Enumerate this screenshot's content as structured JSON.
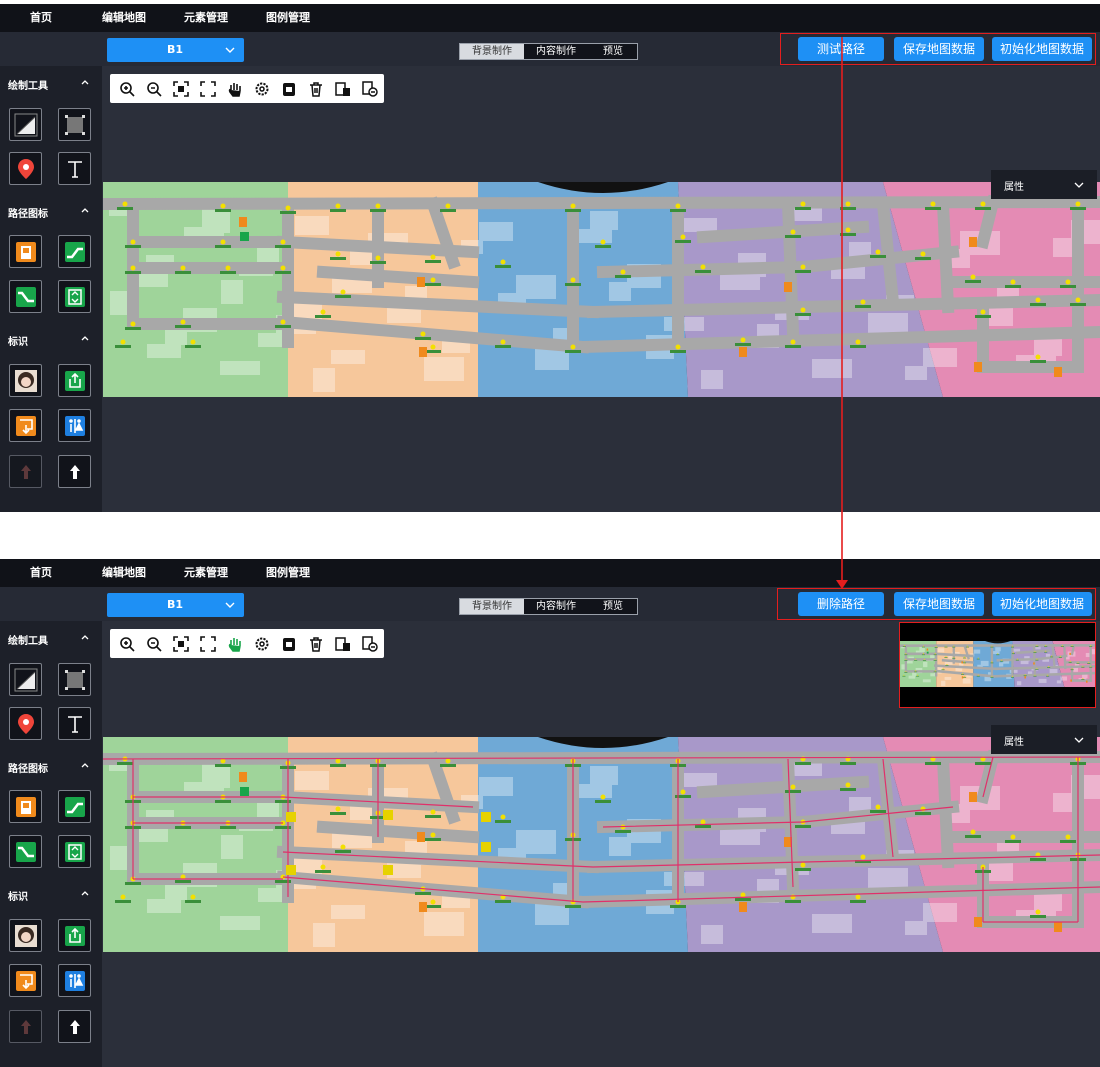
{
  "nav": {
    "items": [
      "首页",
      "编辑地图",
      "元素管理",
      "图例管理"
    ]
  },
  "floor": {
    "value": "B1"
  },
  "mode_tabs": [
    "背景制作",
    "内容制作",
    "预览"
  ],
  "actions_top": {
    "route_button": "测试路径",
    "save_button": "保存地图数据",
    "init_button": "初始化地图数据"
  },
  "actions_bottom": {
    "route_button": "删除路径",
    "save_button": "保存地图数据",
    "init_button": "初始化地图数据"
  },
  "sidebar": {
    "sections": [
      {
        "title": "绘制工具",
        "tools": [
          "line-tool-icon",
          "rect-select-tool-icon",
          "location-pin-icon",
          "text-tool-icon"
        ]
      },
      {
        "title": "路径图标",
        "tools": [
          "elevator-icon",
          "escalator-up-icon",
          "escalator-down-icon",
          "lift-icon"
        ]
      },
      {
        "title": "标识",
        "tools": [
          "avatar-icon",
          "exit-icon",
          "entrance-icon",
          "restroom-icon",
          "arrow-up-disabled-icon",
          "arrow-up-icon"
        ]
      }
    ]
  },
  "map_tools": [
    "zoom-in-icon",
    "zoom-out-icon",
    "fit-icon",
    "fullscreen-icon",
    "pan-hand-icon",
    "settings-icon",
    "lock-icon",
    "delete-icon",
    "copy-delete-icon",
    "copy-remove-icon"
  ],
  "properties_panel": {
    "title": "属性"
  },
  "colors": {
    "accent": "#1e90f5",
    "annotation": "#e41e1e",
    "zone_green": "#9fd49a",
    "zone_peach": "#f6c79b",
    "zone_blue": "#6fa9d6",
    "zone_purple": "#a898c9",
    "zone_pink": "#e48bb4",
    "route": "#e0306a"
  }
}
